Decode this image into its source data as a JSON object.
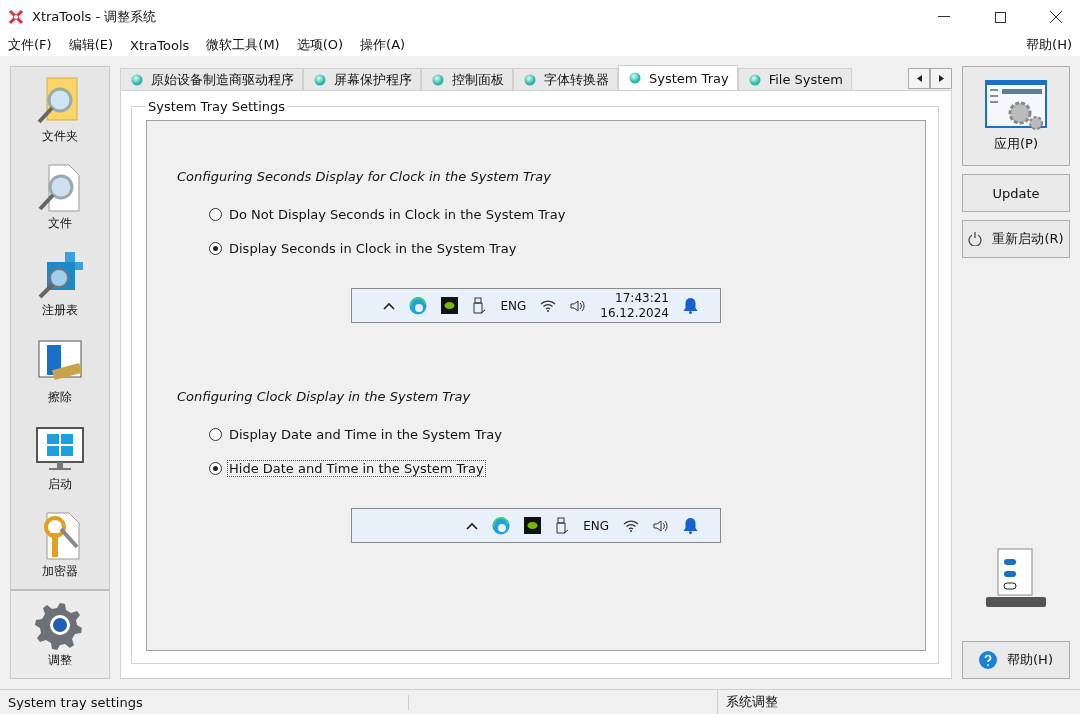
{
  "window": {
    "title": "XtraTools - 调整系统"
  },
  "menu": {
    "items": [
      "文件(F)",
      "编辑(E)",
      "XtraTools",
      "微软工具(M)",
      "选项(O)",
      "操作(A)"
    ],
    "help": "帮助(H)"
  },
  "sidebar": {
    "items": [
      {
        "kind": "folder",
        "label": "文件夹",
        "selected": false
      },
      {
        "kind": "file",
        "label": "文件",
        "selected": false
      },
      {
        "kind": "registry",
        "label": "注册表",
        "selected": false
      },
      {
        "kind": "erase",
        "label": "擦除",
        "selected": false
      },
      {
        "kind": "startup",
        "label": "启动",
        "selected": false
      },
      {
        "kind": "encrypt",
        "label": "加密器",
        "selected": false
      },
      {
        "kind": "tweak",
        "label": "调整",
        "selected": true
      }
    ]
  },
  "tabs": [
    {
      "label": "原始设备制造商驱动程序",
      "selected": false
    },
    {
      "label": "屏幕保护程序",
      "selected": false
    },
    {
      "label": "控制面板",
      "selected": false
    },
    {
      "label": "字体转换器",
      "selected": false
    },
    {
      "label": "System Tray",
      "selected": true
    },
    {
      "label": "File System",
      "selected": false
    }
  ],
  "group": {
    "title": "System Tray Settings",
    "sections": [
      {
        "heading": "Configuring Seconds Display for Clock in the System Tray",
        "options": [
          {
            "label": "Do Not Display Seconds in Clock in the System Tray",
            "selected": false
          },
          {
            "label": "Display Seconds in Clock in the System Tray",
            "selected": true
          }
        ],
        "tray": {
          "language": "ENG",
          "time": "17:43:21",
          "date": "16.12.2024"
        }
      },
      {
        "heading": "Configuring Clock Display in the System Tray",
        "options": [
          {
            "label": "Display Date and Time in the System Tray",
            "selected": false
          },
          {
            "label": "Hide Date and Time in the System Tray",
            "selected": true
          }
        ],
        "tray": {
          "language": "ENG"
        }
      }
    ]
  },
  "actions": {
    "apply": "应用(P)",
    "update": "Update",
    "restart": "重新启动(R)",
    "help": "帮助(H)"
  },
  "status_bar": {
    "left": "System tray settings",
    "right": "系统调整"
  }
}
